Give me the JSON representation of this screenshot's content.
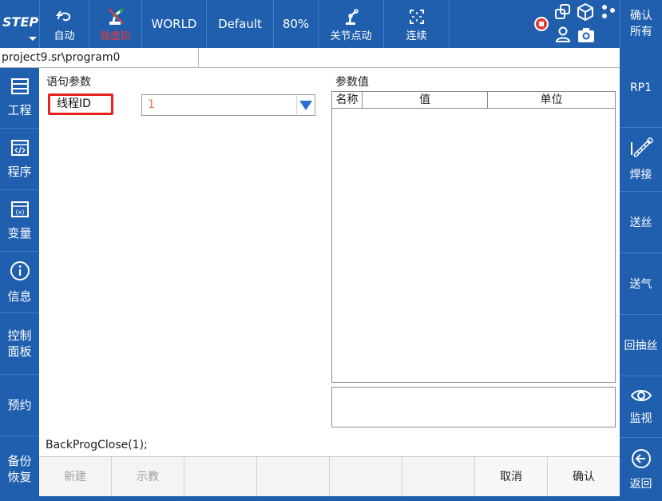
{
  "topbar": {
    "logo": "STEP",
    "mode_label": "自动",
    "sim_label": "轴虚拟",
    "coord_label": "WORLD",
    "tool_label": "Default",
    "speed_label": "80%",
    "jog_label": "关节点动",
    "continuous_label": "连续",
    "confirm_all_label": "确认所有"
  },
  "path": "project9.sr\\program0",
  "left_nav": [
    {
      "label": "工程",
      "icon": "project-icon"
    },
    {
      "label": "程序",
      "icon": "program-icon"
    },
    {
      "label": "变量",
      "icon": "variable-icon"
    },
    {
      "label": "信息",
      "icon": "info-icon"
    },
    {
      "label": "控制面板",
      "icon": ""
    },
    {
      "label": "预约",
      "icon": ""
    },
    {
      "label": "备份恢复",
      "icon": ""
    }
  ],
  "right_nav": [
    {
      "label": "RP1",
      "icon": ""
    },
    {
      "label": "焊接",
      "icon": "welding-torch-icon"
    },
    {
      "label": "送丝",
      "icon": ""
    },
    {
      "label": "送气",
      "icon": ""
    },
    {
      "label": "回抽丝",
      "icon": ""
    },
    {
      "label": "监视",
      "icon": "eye-icon"
    },
    {
      "label": "返回",
      "icon": "back-arrow-icon"
    }
  ],
  "params": {
    "section_title": "语句参数",
    "field_label": "线程ID",
    "field_value": "1"
  },
  "values": {
    "section_title": "参数值",
    "columns": [
      "名称",
      "值",
      "单位"
    ],
    "rows": []
  },
  "statement": "BackProgClose(1);",
  "actions": {
    "new_label": "新建",
    "teach_label": "示教",
    "cancel_label": "取消",
    "confirm_label": "确认"
  },
  "colors": {
    "primary": "#1f5fae",
    "highlight_border": "#e5231c",
    "dropdown_arrow": "#2a6fd0",
    "value_text": "#e8735a",
    "stop_red": "#e53935"
  }
}
